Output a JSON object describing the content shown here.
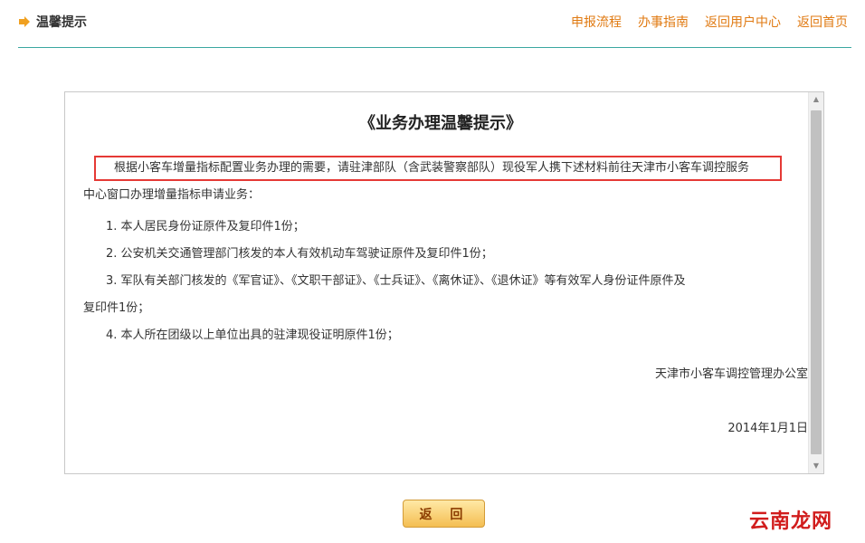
{
  "header": {
    "title": "温馨提示",
    "nav": [
      "申报流程",
      "办事指南",
      "返回用户中心",
      "返回首页"
    ],
    "accent_color": "#e07a12",
    "rule_color": "#3aa7a0"
  },
  "document": {
    "title": "《业务办理温馨提示》",
    "intro_line1": "根据小客车增量指标配置业务办理的需要，请驻津部队（含武装警察部队）现役军人携下述材料前往天津市小客车调控服务",
    "intro_line2": "中心窗口办理增量指标申请业务：",
    "items": [
      {
        "text": "1. 本人居民身份证原件及复印件1份；",
        "cont": ""
      },
      {
        "text": "2. 公安机关交通管理部门核发的本人有效机动车驾驶证原件及复印件1份；",
        "cont": ""
      },
      {
        "text": "3. 军队有关部门核发的《军官证》、《文职干部证》、《士兵证》、《离休证》、《退休证》等有效军人身份证件原件及",
        "cont": "复印件1份；"
      },
      {
        "text": "4. 本人所在团级以上单位出具的驻津现役证明原件1份；",
        "cont": ""
      }
    ],
    "signature": "天津市小客车调控管理办公室",
    "date": "2014年1月1日"
  },
  "return_button": {
    "label": "返 回"
  },
  "watermark": "云南龙网",
  "icons": {
    "header": "arrow-right-icon"
  }
}
